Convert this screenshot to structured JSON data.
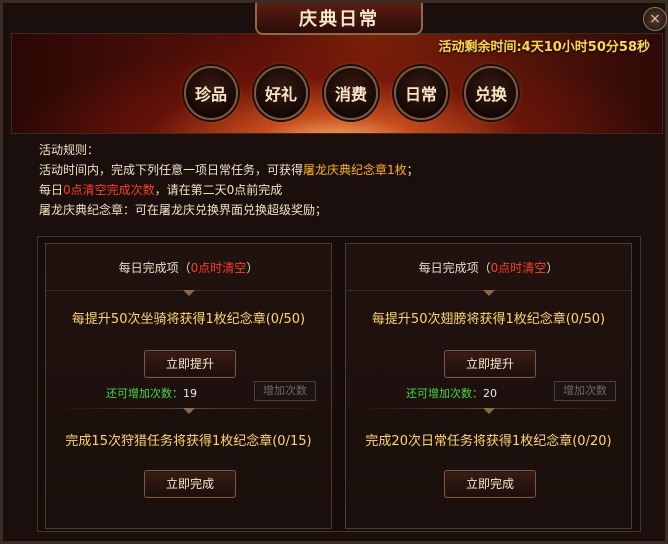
{
  "window": {
    "title": "庆典日常",
    "close_glyph": "×"
  },
  "banner": {
    "countdown": "活动剩余时间:4天10小时50分58秒",
    "tabs": [
      {
        "label": "珍品"
      },
      {
        "label": "好礼"
      },
      {
        "label": "消费"
      },
      {
        "label": "日常"
      },
      {
        "label": "兑换"
      }
    ]
  },
  "rules": {
    "line1": "活动规则：",
    "line2_prefix": "活动时间内，完成下列任意一项日常任务，可获得",
    "line2_link": "屠龙庆典纪念章1枚",
    "line2_suffix": "；",
    "line3_prefix": "每日",
    "line3_red": "0点清空完成次数",
    "line3_suffix": "，请在第二天0点前完成",
    "line4": "屠龙庆典纪念章：可在屠龙庆兑换界面兑换超级奖励；"
  },
  "panels": [
    {
      "header_prefix": "每日完成项（",
      "header_red": "0点时清空",
      "header_suffix": "）",
      "task1_text": "每提升50次坐骑将获得1枚纪念章(0/50)",
      "task1_button": "立即提升",
      "remain_label": "还可增加次数：",
      "remain_value": "19",
      "add_button": "增加次数",
      "task2_text": "完成15次狩猎任务将获得1枚纪念章(0/15)",
      "task2_button": "立即完成"
    },
    {
      "header_prefix": "每日完成项（",
      "header_red": "0点时清空",
      "header_suffix": "）",
      "task1_text": "每提升50次翅膀将获得1枚纪念章(0/50)",
      "task1_button": "立即提升",
      "remain_label": "还可增加次数：",
      "remain_value": "20",
      "add_button": "增加次数",
      "task2_text": "完成20次日常任务将获得1枚纪念章(0/20)",
      "task2_button": "立即完成"
    }
  ],
  "colors": {
    "accent_gold": "#ffd84a",
    "red_text": "#ff3c2a",
    "green_text": "#47d64a"
  }
}
